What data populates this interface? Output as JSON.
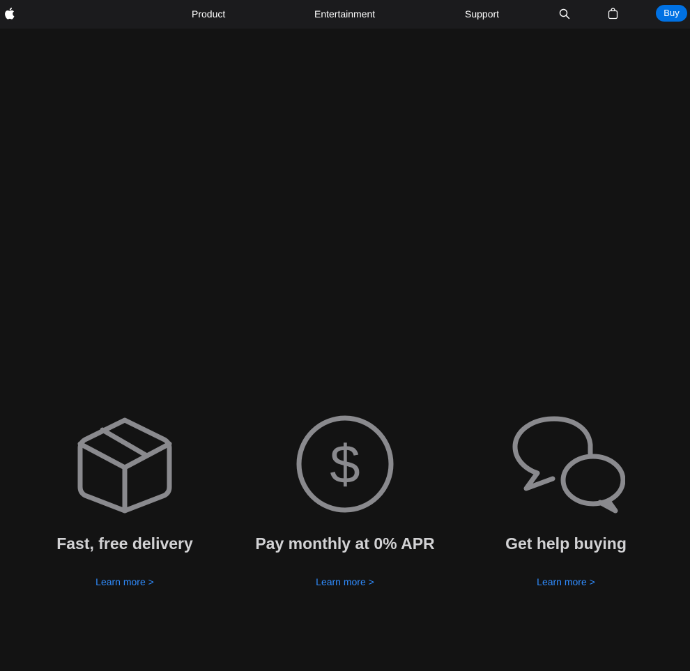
{
  "nav": {
    "logo_icon": "apple-logo-icon",
    "items": [
      {
        "label": "Product"
      },
      {
        "label": "Entertainment"
      },
      {
        "label": "Support"
      }
    ],
    "search_icon": "search-icon",
    "bag_icon": "bag-icon",
    "buy_label": "Buy"
  },
  "features": [
    {
      "icon": "box-icon",
      "title": "Fast, free delivery",
      "link": "Learn more >"
    },
    {
      "icon": "dollar-circle-icon",
      "title": "Pay monthly at 0% APR",
      "link": "Learn more >"
    },
    {
      "icon": "chat-bubbles-icon",
      "title": "Get help buying",
      "link": "Learn more >"
    }
  ],
  "colors": {
    "background": "#131313",
    "nav_background": "#1b1b1d",
    "accent": "#0071e3",
    "link": "#2f8cff",
    "icon_gray": "#8a8a8e",
    "title": "#d2d2d4"
  }
}
